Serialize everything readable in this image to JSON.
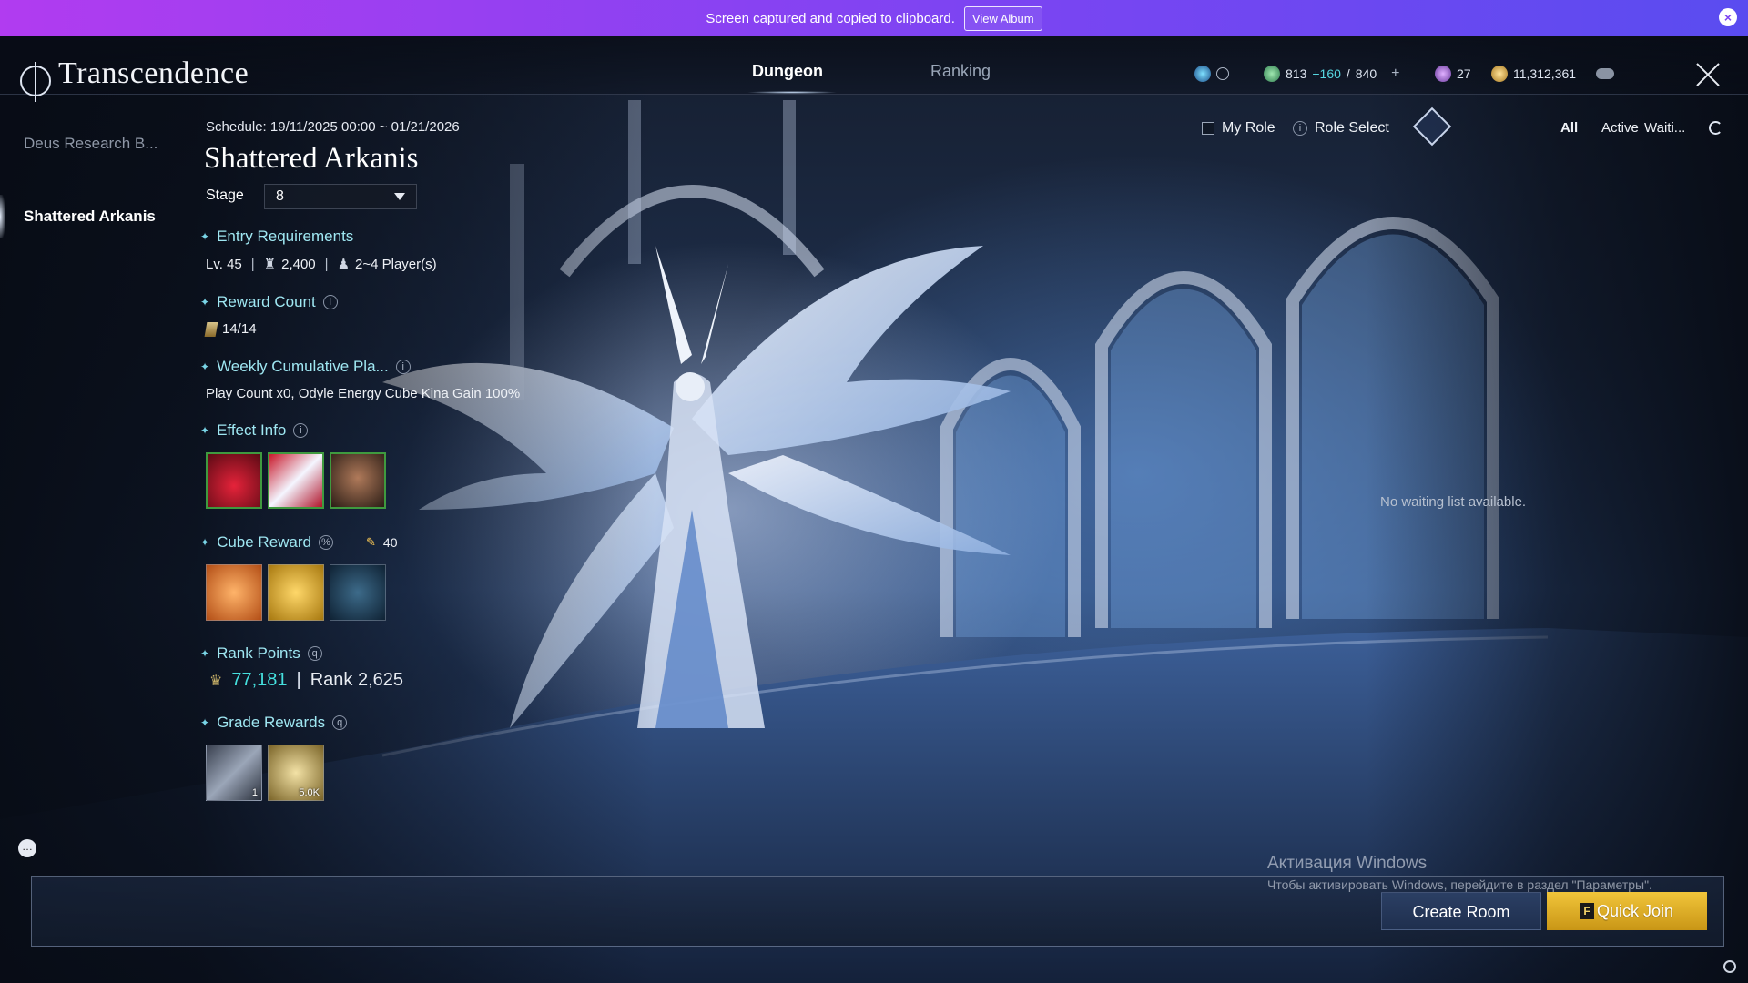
{
  "capture_banner": {
    "message": "Screen captured and copied to clipboard.",
    "button_label": "View Album"
  },
  "header": {
    "title": "Transcendence",
    "tabs": [
      "Dungeon",
      "Ranking"
    ],
    "resources": {
      "energy": "813",
      "energy_bonus": "+160",
      "energy_max": "840",
      "count_a": "27",
      "kina": "11,312,361"
    }
  },
  "sidebar": {
    "items": [
      "Deus Research B...",
      "Shattered Arkanis"
    ]
  },
  "dungeon": {
    "schedule": "Schedule: 19/11/2025 00:00 ~ 01/21/2026",
    "name": "Shattered Arkanis",
    "stage_label": "Stage",
    "stage_value": "8",
    "entry_title": "Entry Requirements",
    "entry_level": "Lv. 45",
    "entry_power": "2,400",
    "entry_players": "2~4 Player(s)",
    "reward_count_title": "Reward Count",
    "reward_count": "14/14",
    "weekly_title": "Weekly Cumulative Pla...",
    "weekly_text": "Play Count x0, Odyle Energy Cube Kina Gain 100%",
    "effect_title": "Effect Info",
    "cube_title": "Cube Reward",
    "cube_cost": "40",
    "rank_title": "Rank Points",
    "rank_points": "77,181",
    "rank": "Rank 2,625",
    "grade_title": "Grade Rewards",
    "grade_qty_1": "1",
    "grade_qty_2": "5.0K"
  },
  "filters": {
    "my_role": "My Role",
    "role_select": "Role Select",
    "all": "All",
    "active": "Active",
    "waiting": "Waiti..."
  },
  "waiting_list": {
    "empty": "No waiting list available."
  },
  "actions": {
    "create_room": "Create Room",
    "quick_join_key": "F",
    "quick_join": "Quick Join"
  },
  "windows_activation": {
    "line1": "Активация Windows",
    "line2": "Чтобы активировать Windows, перейдите в раздел \"Параметры\"."
  },
  "colors": {
    "accent_cyan": "#9fe7f2",
    "rank_points": "#45e0de",
    "quick_join": "#e0b12a",
    "banner": "#8a40f0"
  }
}
